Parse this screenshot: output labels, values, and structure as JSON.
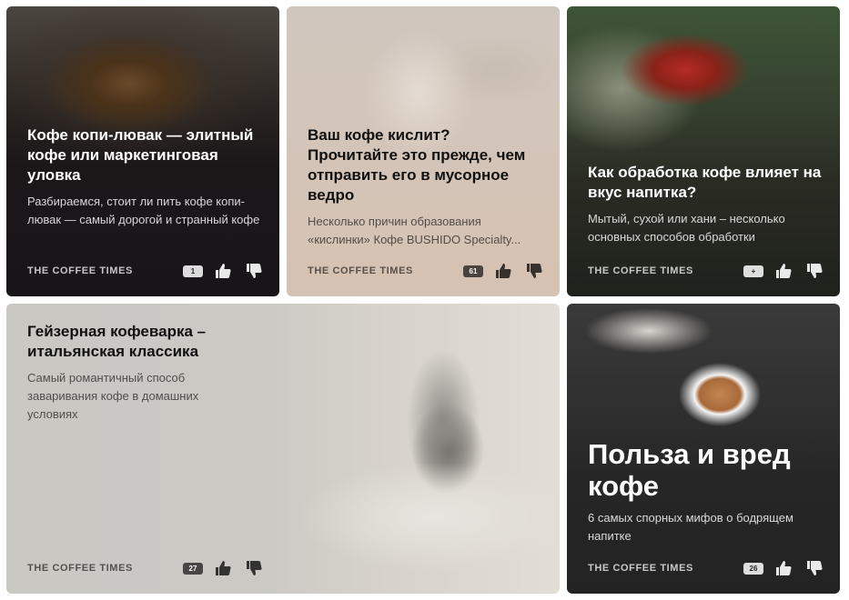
{
  "cards": [
    {
      "title": "Кофе копи-лювак — элитный кофе или маркетинговая уловка",
      "description": "Разбираемся, стоит ли пить кофе копи-лювак — самый дорогой и странный кофе",
      "source": "THE COFFEE TIMES",
      "comments": "1",
      "theme": "dark-image"
    },
    {
      "title": "Ваш кофе кислит? Прочитайте это прежде, чем отправить его в мусорное ведро",
      "description": "Несколько причин образования «кислинки» Кофе BUSHIDO Specialty...",
      "source": "THE COFFEE TIMES",
      "comments": "61",
      "theme": "light-image"
    },
    {
      "title": "Как обработка кофе влияет на вкус напитка?",
      "description": "Мытый, сухой или хани – несколько основных способов обработки",
      "source": "THE COFFEE TIMES",
      "comments": "+",
      "theme": "dark-image"
    },
    {
      "title": "Гейзерная кофеварка – итальянская классика",
      "description": "Самый романтичный способ заваривания кофе в домашних условиях",
      "source": "THE COFFEE TIMES",
      "comments": "27",
      "theme": "light-image"
    },
    {
      "title": "Польза и вред кофе",
      "description": "6 самых спорных мифов о бодрящем напитке",
      "source": "THE COFFEE TIMES",
      "comments": "26",
      "theme": "dark-image"
    }
  ],
  "icons": {
    "comment": "comment-bubble-icon",
    "like": "thumbs-up-icon",
    "dislike": "thumbs-down-icon"
  },
  "colors": {
    "text_on_dark": "#ffffff",
    "text_on_light": "#111111"
  }
}
